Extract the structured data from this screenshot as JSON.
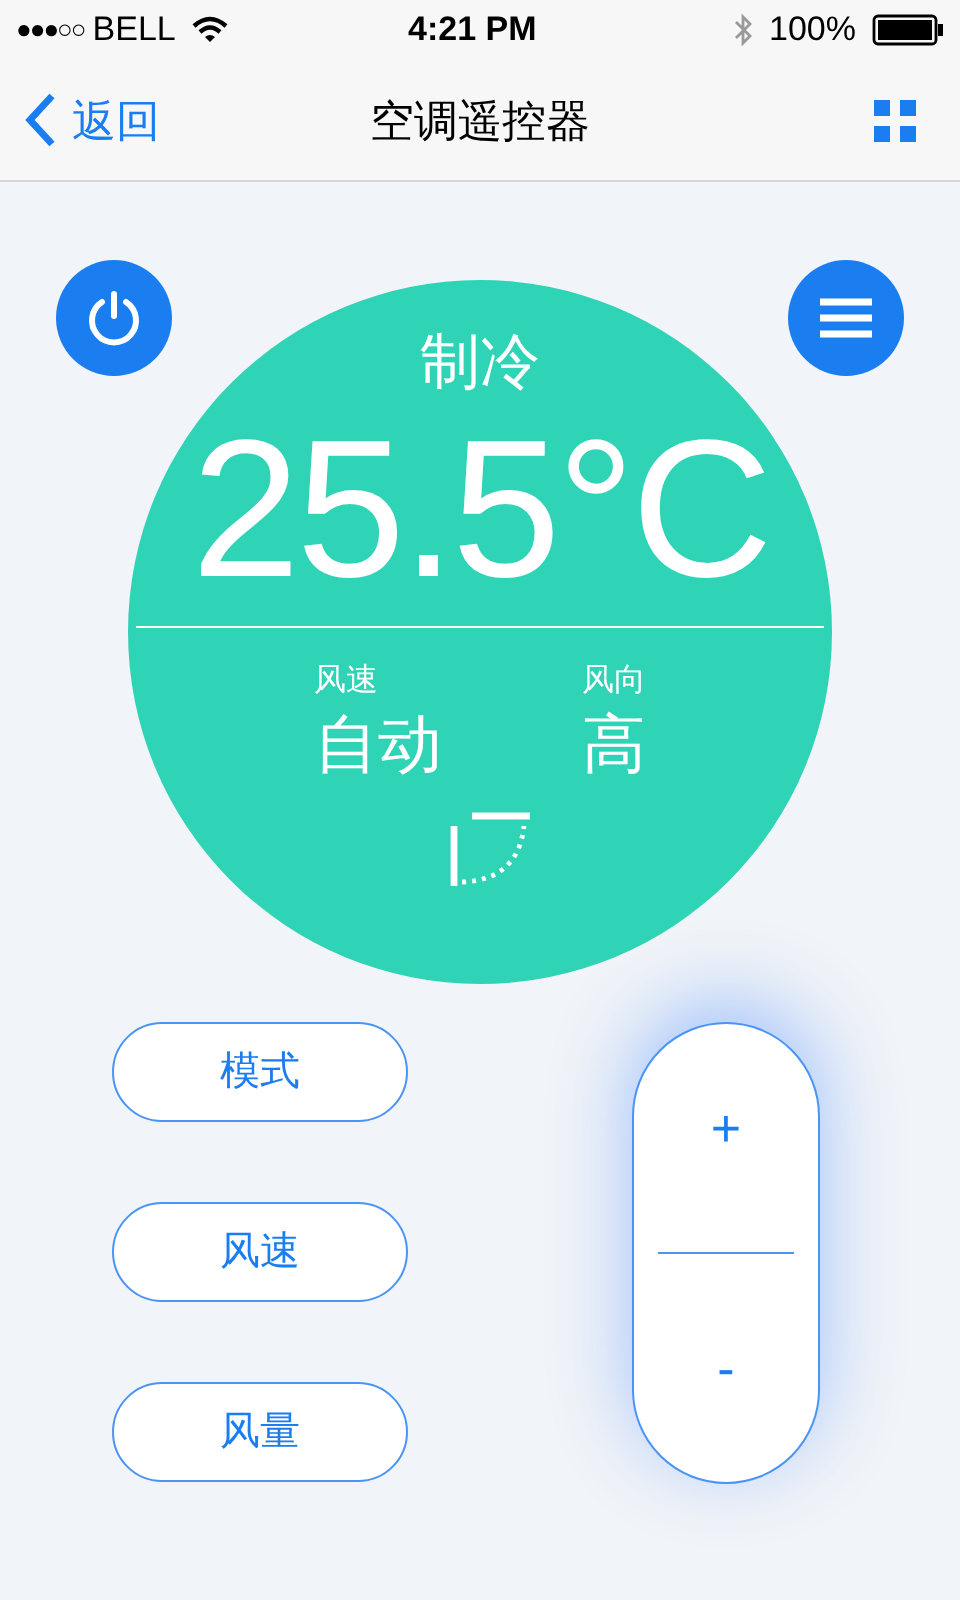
{
  "status_bar": {
    "signal": "●●●○○",
    "carrier": "BELL",
    "time": "4:21 PM",
    "battery": "100%"
  },
  "nav": {
    "back": "返回",
    "title": "空调遥控器"
  },
  "display": {
    "mode": "制冷",
    "temperature": "25.5°C",
    "readings": [
      {
        "label": "风速",
        "value": "自动"
      },
      {
        "label": "风向",
        "value": "高"
      }
    ]
  },
  "buttons": [
    "模式",
    "风速",
    "风量"
  ],
  "adjuster": {
    "increase": "+",
    "decrease": "-"
  }
}
